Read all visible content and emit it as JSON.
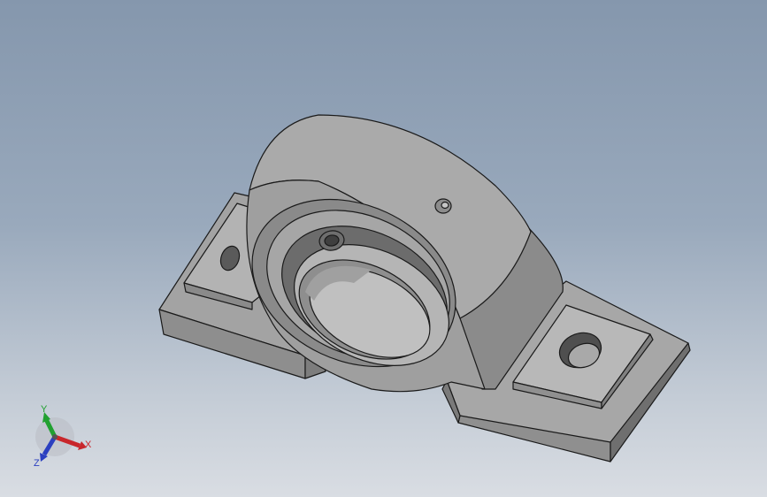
{
  "viewport": {
    "background_top": "#8597ad",
    "background_bottom": "#d9dde3"
  },
  "model": {
    "part_color": "#9a9a9a",
    "edge_color": "#1a1a1a"
  },
  "triad": {
    "x_label": "X",
    "y_label": "Y",
    "z_label": "Z",
    "x_color": "#c8262b",
    "y_color": "#21a030",
    "z_color": "#2b3fc0"
  }
}
